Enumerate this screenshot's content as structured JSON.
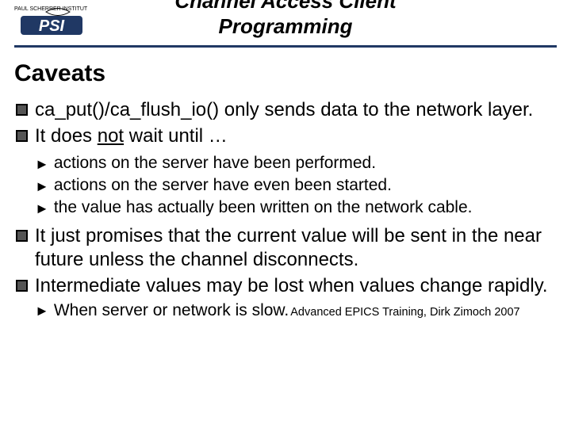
{
  "logo": {
    "institute_line": "PAUL SCHERRER INSTITUT",
    "abbr": "PSI"
  },
  "slide_title_line1": "Channel Access Client",
  "slide_title_line2": "Programming",
  "section_title": "Caveats",
  "bullets": [
    {
      "level": 1,
      "text": "ca_put()/ca_flush_io() only sends data to the network layer."
    },
    {
      "level": 1,
      "html": "It does <span class=\"underline\">not</span> wait until …"
    },
    {
      "level": 2,
      "text": "actions on the server have been performed."
    },
    {
      "level": 2,
      "text": "actions on the server have even been started."
    },
    {
      "level": 2,
      "text": "the value has actually been written on the network cable."
    },
    {
      "level": 1,
      "text": "It just promises that the current value will be sent in the near future unless the channel disconnects."
    },
    {
      "level": 1,
      "text": "Intermediate values may be lost when values change rapidly."
    }
  ],
  "last_sub_bullet": "When server or network is slow.",
  "footer": "Advanced EPICS Training, Dirk Zimoch 2007"
}
